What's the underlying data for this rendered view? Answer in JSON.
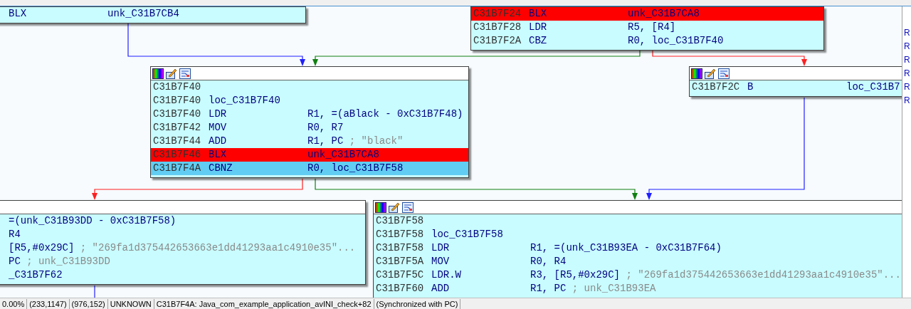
{
  "graph": {
    "nodes": [
      {
        "toolbar": false,
        "rows": [
          {
            "kind": "normal",
            "mnemonic": "BLX",
            "operand": "unk_C31B7CB4"
          }
        ]
      },
      {
        "toolbar": false,
        "rows": [
          {
            "kind": "breakpoint",
            "address": "C31B7F24",
            "mnemonic": "BLX",
            "operand": "unk_C31B7CA8"
          },
          {
            "kind": "normal",
            "address": "C31B7F28",
            "mnemonic": "LDR",
            "operand": "R5, [R4]"
          },
          {
            "kind": "normal",
            "address": "C31B7F2A",
            "mnemonic": "CBZ",
            "operand": "R0, loc_C31B7F40"
          }
        ]
      },
      {
        "toolbar": true,
        "rows": [
          {
            "kind": "normal",
            "address": "C31B7F40"
          },
          {
            "kind": "normal",
            "address": "C31B7F40",
            "label": "loc_C31B7F40"
          },
          {
            "kind": "normal",
            "address": "C31B7F40",
            "mnemonic": "LDR",
            "operand": "R1, =(aBlack - 0xC31B7F48)"
          },
          {
            "kind": "normal",
            "address": "C31B7F42",
            "mnemonic": "MOV",
            "operand": "R0, R7"
          },
          {
            "kind": "normal",
            "address": "C31B7F44",
            "mnemonic": "ADD",
            "operand": "R1, PC",
            "comment": "; \"black\""
          },
          {
            "kind": "breakpoint",
            "address": "C31B7F46",
            "mnemonic": "BLX",
            "operand": "unk_C31B7CA8"
          },
          {
            "kind": "current",
            "address": "C31B7F4A",
            "mnemonic": "CBNZ",
            "operand": "R0, loc_C31B7F58"
          }
        ]
      },
      {
        "toolbar": true,
        "rows": [
          {
            "kind": "normal",
            "address": "C31B7F2C",
            "mnemonic": "B",
            "operand": "loc_C31B7"
          }
        ]
      },
      {
        "toolbar": true,
        "rows": [
          {
            "kind": "normal",
            "operand": "=(unk_C31B93DD - 0xC31B7F58)"
          },
          {
            "kind": "normal",
            "operand": "R4"
          },
          {
            "kind": "normal",
            "operand": "[R5,#0x29C]",
            "comment": "; \"269fa1d375442653663e1dd41293aa1c4910e35\"..."
          },
          {
            "kind": "normal",
            "operand": "PC",
            "comment": "; unk_C31B93DD"
          },
          {
            "kind": "normal",
            "operand": "_C31B7F62"
          }
        ]
      },
      {
        "toolbar": true,
        "rows": [
          {
            "kind": "normal",
            "address": "C31B7F58"
          },
          {
            "kind": "normal",
            "address": "C31B7F58",
            "label": "loc_C31B7F58"
          },
          {
            "kind": "normal",
            "address": "C31B7F58",
            "mnemonic": "LDR",
            "operand": "R1, =(unk_C31B93EA - 0xC31B7F64)"
          },
          {
            "kind": "normal",
            "address": "C31B7F5A",
            "mnemonic": "MOV",
            "operand": "R0, R4"
          },
          {
            "kind": "normal",
            "address": "C31B7F5C",
            "mnemonic": "LDR.W",
            "operand": "R3, [R5,#0x29C]",
            "comment": "; \"269fa1d375442653663e1dd41293aa1c4910e35\"..."
          },
          {
            "kind": "normal",
            "address": "C31B7F60",
            "mnemonic": "ADD",
            "operand": "R1, PC",
            "comment": "; unk_C31B93EA"
          }
        ]
      }
    ]
  },
  "right_panel": {
    "items": [
      "R",
      "R",
      "R",
      "R",
      "R",
      "R"
    ]
  },
  "status_bar": [
    "0.00%",
    "(233,1147)",
    "(976,152)",
    "UNKNOWN",
    "C31B7F4A: Java_com_example_application_avINI_check+82",
    "(Synchronized with PC)"
  ]
}
